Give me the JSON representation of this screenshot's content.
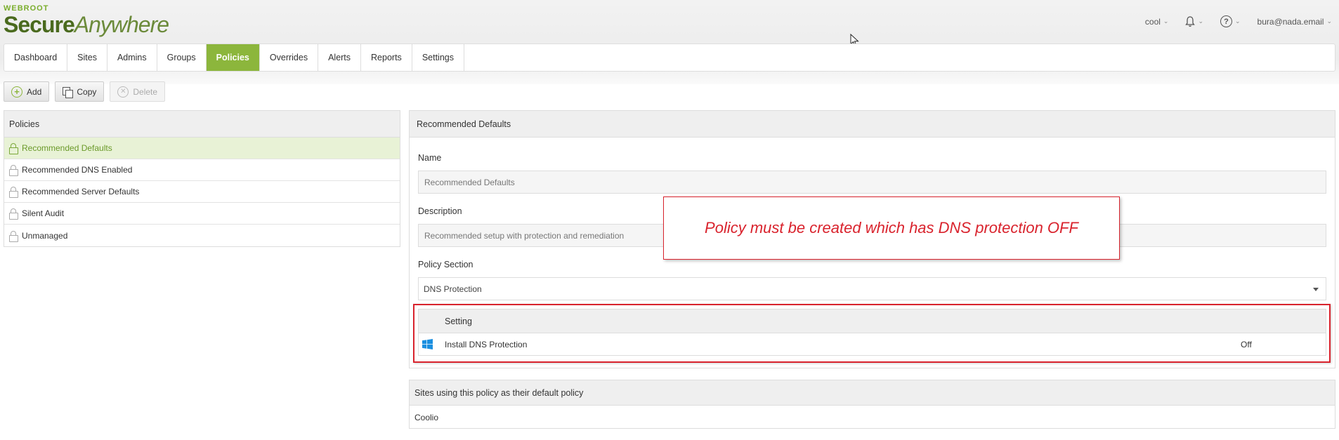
{
  "brand": {
    "top": "WEBROOT",
    "secure": "Secure",
    "anywhere": "Anywhere",
    "accent": "#8cb63c"
  },
  "header": {
    "account": "cool",
    "user_email": "bura@nada.email",
    "help_glyph": "?"
  },
  "nav": {
    "tabs": [
      {
        "label": "Dashboard"
      },
      {
        "label": "Sites"
      },
      {
        "label": "Admins"
      },
      {
        "label": "Groups"
      },
      {
        "label": "Policies"
      },
      {
        "label": "Overrides"
      },
      {
        "label": "Alerts"
      },
      {
        "label": "Reports"
      },
      {
        "label": "Settings"
      }
    ],
    "active": "Policies"
  },
  "toolbar": {
    "add_label": "Add",
    "copy_label": "Copy",
    "delete_label": "Delete"
  },
  "policies": {
    "title": "Policies",
    "items": [
      {
        "label": "Recommended Defaults"
      },
      {
        "label": "Recommended DNS Enabled"
      },
      {
        "label": "Recommended Server Defaults"
      },
      {
        "label": "Silent Audit"
      },
      {
        "label": "Unmanaged"
      }
    ],
    "selected": "Recommended Defaults"
  },
  "details": {
    "title": "Recommended Defaults",
    "name_label": "Name",
    "name_value": "Recommended Defaults",
    "description_label": "Description",
    "description_value": "Recommended setup with protection and remediation",
    "section_label": "Policy Section",
    "section_value": "DNS Protection",
    "table_header": "Setting",
    "rows": [
      {
        "setting": "Install DNS Protection",
        "value": "Off"
      }
    ]
  },
  "sites": {
    "title": "Sites using this policy as their default policy",
    "items": [
      "Coolio"
    ]
  },
  "annotation": {
    "text": "Policy must be created which has DNS protection OFF",
    "color": "#d9232d"
  }
}
